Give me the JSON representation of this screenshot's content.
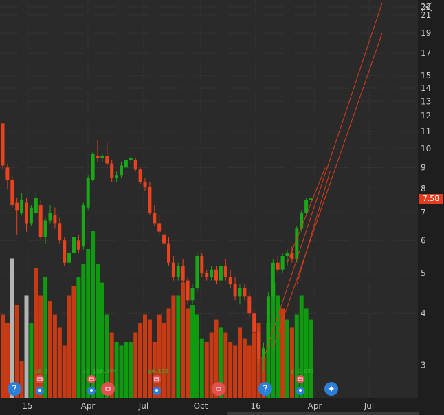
{
  "price_axis": {
    "labels": [
      "22",
      "21",
      "19",
      "17",
      "15",
      "14",
      "13",
      "12",
      "11",
      "10",
      "9",
      "8",
      "7",
      "6",
      "5",
      "4",
      "3"
    ],
    "values": [
      22,
      21,
      19,
      17,
      15,
      14,
      13,
      12,
      11,
      10,
      9,
      8,
      7,
      6,
      5,
      4,
      3
    ]
  },
  "time_axis": {
    "labels": [
      "15",
      "Apr",
      "Jul",
      "Oct",
      "16",
      "Apr",
      "Jul"
    ]
  },
  "current_price": "7.58",
  "colors": {
    "background": "#2a2a2a",
    "grid": "#3c3c3c",
    "up": "#18a818",
    "down": "#e8431e",
    "volume_up": "#0f9a0f",
    "volume_down": "#c73b14",
    "volume_neutral": "#b4b4b4",
    "trendline": "#e03c1c",
    "axis_text": "#c8c8c8",
    "price_tag": "#e23d20",
    "event_blue": "#2b7fd8",
    "event_red": "#e25050"
  },
  "events": [
    {
      "type": "question-icon",
      "label": ""
    },
    {
      "type": "earnings-icon",
      "label": "$0.3"
    },
    {
      "type": "dividend-icon",
      "label": ""
    },
    {
      "type": "earnings-icon",
      "label": "$0.138"
    },
    {
      "type": "dividend-icon",
      "label": "$0.074"
    },
    {
      "type": "earnings-icon",
      "label": ""
    },
    {
      "type": "earnings-icon",
      "label": "$0.133"
    },
    {
      "type": "dividend-icon",
      "label": ""
    },
    {
      "type": "earnings-icon",
      "label": ""
    },
    {
      "type": "question-icon",
      "label": ""
    },
    {
      "type": "earnings-icon",
      "label": "$-0.053"
    },
    {
      "type": "dividend-icon",
      "label": ""
    },
    {
      "type": "lightbulb-icon",
      "label": ""
    }
  ],
  "chart_data": {
    "type": "candlestick",
    "x_range": [
      "2015-01",
      "2016-08"
    ],
    "y_scale": "log",
    "y_range": [
      2.5,
      22.5
    ],
    "candles": [
      [
        11.5,
        11.5,
        8.9,
        9.1
      ],
      [
        9.0,
        9.2,
        8.0,
        8.4
      ],
      [
        8.4,
        8.6,
        7.2,
        7.3
      ],
      [
        7.4,
        7.6,
        6.2,
        7.1
      ],
      [
        7.0,
        7.8,
        6.9,
        7.5
      ],
      [
        7.4,
        7.6,
        6.3,
        6.6
      ],
      [
        6.6,
        7.3,
        6.5,
        7.2
      ],
      [
        7.0,
        7.8,
        6.9,
        7.6
      ],
      [
        7.3,
        7.5,
        6.0,
        6.1
      ],
      [
        6.1,
        6.8,
        5.9,
        6.7
      ],
      [
        6.7,
        7.3,
        6.6,
        7.0
      ],
      [
        6.9,
        7.2,
        6.4,
        6.6
      ],
      [
        6.6,
        6.8,
        5.9,
        6.0
      ],
      [
        6.0,
        6.1,
        5.2,
        5.3
      ],
      [
        5.3,
        5.7,
        5.0,
        5.6
      ],
      [
        5.6,
        6.2,
        5.4,
        6.1
      ],
      [
        6.0,
        6.2,
        5.6,
        5.7
      ],
      [
        5.8,
        7.4,
        5.7,
        7.3
      ],
      [
        7.2,
        8.6,
        7.1,
        8.5
      ],
      [
        8.4,
        9.8,
        8.3,
        9.7
      ],
      [
        9.6,
        10.5,
        9.3,
        9.5
      ],
      [
        9.5,
        9.7,
        9.3,
        9.6
      ],
      [
        9.6,
        10.4,
        9.0,
        9.2
      ],
      [
        9.2,
        9.4,
        8.3,
        8.5
      ],
      [
        8.5,
        8.8,
        8.3,
        8.6
      ],
      [
        8.6,
        9.3,
        8.5,
        9.1
      ],
      [
        9.0,
        9.6,
        8.9,
        9.4
      ],
      [
        9.4,
        9.6,
        9.2,
        9.5
      ],
      [
        9.4,
        9.5,
        8.8,
        8.9
      ],
      [
        8.9,
        9.0,
        8.2,
        8.3
      ],
      [
        8.3,
        8.5,
        7.9,
        8.1
      ],
      [
        8.1,
        8.3,
        6.9,
        7.0
      ],
      [
        7.0,
        7.3,
        6.5,
        6.6
      ],
      [
        6.6,
        6.9,
        6.2,
        6.3
      ],
      [
        6.2,
        6.4,
        5.8,
        5.9
      ],
      [
        5.9,
        6.1,
        5.2,
        5.3
      ],
      [
        5.3,
        5.5,
        4.8,
        4.9
      ],
      [
        4.9,
        5.3,
        4.8,
        5.2
      ],
      [
        5.2,
        5.4,
        4.7,
        4.8
      ],
      [
        4.8,
        4.9,
        4.2,
        4.3
      ],
      [
        4.3,
        4.7,
        4.2,
        4.6
      ],
      [
        4.6,
        5.6,
        4.5,
        5.5
      ],
      [
        5.5,
        5.6,
        4.9,
        5.0
      ],
      [
        5.0,
        5.1,
        4.8,
        4.9
      ],
      [
        4.9,
        5.2,
        4.8,
        5.1
      ],
      [
        5.1,
        5.2,
        4.7,
        4.8
      ],
      [
        4.8,
        5.3,
        4.6,
        5.2
      ],
      [
        5.2,
        5.4,
        4.8,
        4.9
      ],
      [
        4.9,
        5.1,
        4.6,
        4.7
      ],
      [
        4.7,
        4.9,
        4.3,
        4.4
      ],
      [
        4.4,
        4.7,
        4.2,
        4.6
      ],
      [
        4.6,
        4.7,
        4.3,
        4.4
      ],
      [
        4.4,
        4.5,
        3.9,
        4.0
      ],
      [
        4.0,
        4.1,
        3.5,
        3.6
      ],
      [
        3.6,
        3.7,
        3.0,
        3.1
      ],
      [
        3.1,
        3.4,
        2.9,
        3.3
      ],
      [
        3.3,
        4.5,
        3.2,
        4.4
      ],
      [
        4.4,
        5.4,
        4.3,
        5.3
      ],
      [
        5.3,
        5.5,
        5.0,
        5.1
      ],
      [
        5.1,
        5.6,
        5.0,
        5.5
      ],
      [
        5.5,
        5.7,
        5.2,
        5.6
      ],
      [
        5.6,
        5.8,
        5.3,
        5.4
      ],
      [
        5.4,
        6.5,
        5.3,
        6.4
      ],
      [
        6.4,
        7.1,
        6.3,
        7.0
      ],
      [
        7.0,
        7.6,
        6.9,
        7.5
      ],
      [
        7.5,
        7.7,
        7.2,
        7.58
      ]
    ],
    "volume": [
      {
        "v": 0.45,
        "c": "down"
      },
      {
        "v": 0.4,
        "c": "down"
      },
      {
        "v": 0.75,
        "c": "neutral"
      },
      {
        "v": 0.5,
        "c": "down"
      },
      {
        "v": 0.2,
        "c": "down"
      },
      {
        "v": 0.55,
        "c": "neutral"
      },
      {
        "v": 0.4,
        "c": "up"
      },
      {
        "v": 0.7,
        "c": "down"
      },
      {
        "v": 0.55,
        "c": "down"
      },
      {
        "v": 0.65,
        "c": "up"
      },
      {
        "v": 0.52,
        "c": "down"
      },
      {
        "v": 0.45,
        "c": "down"
      },
      {
        "v": 0.38,
        "c": "down"
      },
      {
        "v": 0.28,
        "c": "down"
      },
      {
        "v": 0.55,
        "c": "down"
      },
      {
        "v": 0.6,
        "c": "down"
      },
      {
        "v": 0.65,
        "c": "up"
      },
      {
        "v": 0.72,
        "c": "up"
      },
      {
        "v": 0.8,
        "c": "up"
      },
      {
        "v": 0.9,
        "c": "up"
      },
      {
        "v": 0.72,
        "c": "up"
      },
      {
        "v": 0.62,
        "c": "up"
      },
      {
        "v": 0.45,
        "c": "up"
      },
      {
        "v": 0.35,
        "c": "down"
      },
      {
        "v": 0.3,
        "c": "up"
      },
      {
        "v": 0.28,
        "c": "up"
      },
      {
        "v": 0.3,
        "c": "up"
      },
      {
        "v": 0.3,
        "c": "up"
      },
      {
        "v": 0.35,
        "c": "down"
      },
      {
        "v": 0.4,
        "c": "down"
      },
      {
        "v": 0.45,
        "c": "down"
      },
      {
        "v": 0.42,
        "c": "down"
      },
      {
        "v": 0.3,
        "c": "down"
      },
      {
        "v": 0.45,
        "c": "down"
      },
      {
        "v": 0.4,
        "c": "down"
      },
      {
        "v": 0.48,
        "c": "down"
      },
      {
        "v": 0.55,
        "c": "down"
      },
      {
        "v": 0.55,
        "c": "up"
      },
      {
        "v": 0.62,
        "c": "down"
      },
      {
        "v": 0.48,
        "c": "down"
      },
      {
        "v": 0.5,
        "c": "up"
      },
      {
        "v": 0.45,
        "c": "up"
      },
      {
        "v": 0.32,
        "c": "up"
      },
      {
        "v": 0.3,
        "c": "down"
      },
      {
        "v": 0.35,
        "c": "down"
      },
      {
        "v": 0.42,
        "c": "down"
      },
      {
        "v": 0.38,
        "c": "up"
      },
      {
        "v": 0.35,
        "c": "down"
      },
      {
        "v": 0.3,
        "c": "down"
      },
      {
        "v": 0.28,
        "c": "down"
      },
      {
        "v": 0.38,
        "c": "down"
      },
      {
        "v": 0.32,
        "c": "down"
      },
      {
        "v": 0.28,
        "c": "down"
      },
      {
        "v": 0.35,
        "c": "down"
      },
      {
        "v": 0.4,
        "c": "down"
      },
      {
        "v": 0.22,
        "c": "down"
      },
      {
        "v": 0.4,
        "c": "up"
      },
      {
        "v": 0.62,
        "c": "up"
      },
      {
        "v": 0.55,
        "c": "up"
      },
      {
        "v": 0.48,
        "c": "down"
      },
      {
        "v": 0.42,
        "c": "up"
      },
      {
        "v": 0.38,
        "c": "down"
      },
      {
        "v": 0.45,
        "c": "up"
      },
      {
        "v": 0.55,
        "c": "up"
      },
      {
        "v": 0.48,
        "c": "up"
      },
      {
        "v": 0.42,
        "c": "up"
      }
    ],
    "trendlines": [
      {
        "from": [
          55,
          3.1
        ],
        "to": [
          80,
          22.5
        ]
      },
      {
        "from": [
          57,
          3.3
        ],
        "to": [
          80,
          19
        ]
      },
      {
        "from": [
          60,
          5.3
        ],
        "to": [
          68,
          9
        ]
      },
      {
        "from": [
          62,
          4.7
        ],
        "to": [
          69,
          8.8
        ]
      }
    ]
  }
}
